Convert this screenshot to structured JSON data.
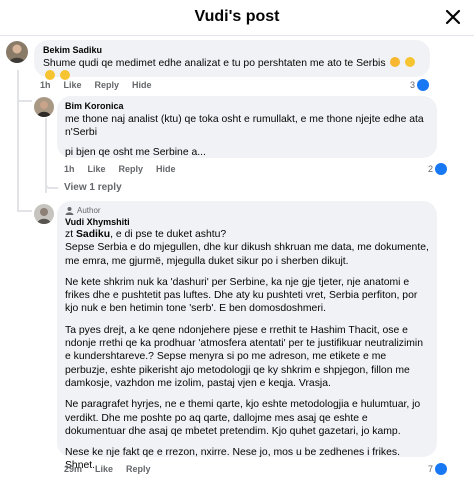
{
  "header": {
    "title": "Vudi's post"
  },
  "comments": [
    {
      "name": "Bekim Sadiku",
      "text": "Shume qudi qe medimet edhe analizat e tu po pershtaten me ato te Serbis",
      "time": "1h",
      "like": "Like",
      "reply": "Reply",
      "hide": "Hide",
      "reactions": "3"
    },
    {
      "name": "Bim Koronica",
      "text": "me thone naj analist (ktu) qe toka osht e rumullakt, e me thone njejte edhe ata n'Serbi",
      "text2": "pi bjen qe osht me Serbine a...",
      "time": "1h",
      "like": "Like",
      "reply": "Reply",
      "hide": "Hide",
      "reactions": "2"
    },
    {
      "author_tag": "Author",
      "name": "Vudi Xhymshiti",
      "mention": "Sadiku",
      "lines": {
        "l1_prefix": "zt ",
        "l1_suffix": ", e di pse te duket ashtu?",
        "l2": "Sepse Serbia e do mjegullen, dhe kur dikush shkruan me data, me dokumente, me emra, me gjurmë, mjegulla duket sikur po i sherben dikujt."
      },
      "paragraphs": [
        "Ne kete shkrim nuk ka 'dashuri' per Serbine, ka nje gje tjeter, nje anatomi e frikes dhe e pushtetit pas luftes. Dhe aty ku pushteti vret, Serbia perfiton, por kjo nuk e ben hetimin tone 'serb'. E ben domosdoshmeri.",
        "Ta pyes drejt, a ke qene ndonjehere pjese e rrethit te Hashim Thacit, ose e ndonje rrethi qe ka prodhuar 'atmosfera atentati' per te justifikuar neutralizimin e kundershtareve.? Sepse menyra si po me adreson, me etikete e me perbuzje, eshte pikerisht ajo metodologji qe ky shkrim e shpjegon, fillon me damkosje, vazhdon me izolim, pastaj vjen e keqja. Vrasja.",
        "Ne paragrafet hyrjes, ne e themi qarte, kjo eshte metodologjia e hulumtuar, jo verdikt. Dhe me poshte po aq qarte, dallojme mes asaj qe eshte e dokumentuar dhe asaj qe mbetet pretendim. Kjo quhet gazetari, jo kamp.",
        "Nese ke nje fakt qe e rrezon, nxirre. Nese jo, mos u be zedhenes i frikes.\nShnet."
      ],
      "time": "29m",
      "like": "Like",
      "reply": "Reply",
      "reactions": "7"
    }
  ],
  "view_replies": "View 1 reply",
  "colors": {
    "like_blue": "#1877f2",
    "meta_gray": "#65676b",
    "bubble_bg": "#f0f2f5"
  },
  "icons": [
    "close-icon",
    "like-icon",
    "reply-thread-icon",
    "author-tag-icon",
    "grinning-emoji",
    "worried-emoji"
  ]
}
